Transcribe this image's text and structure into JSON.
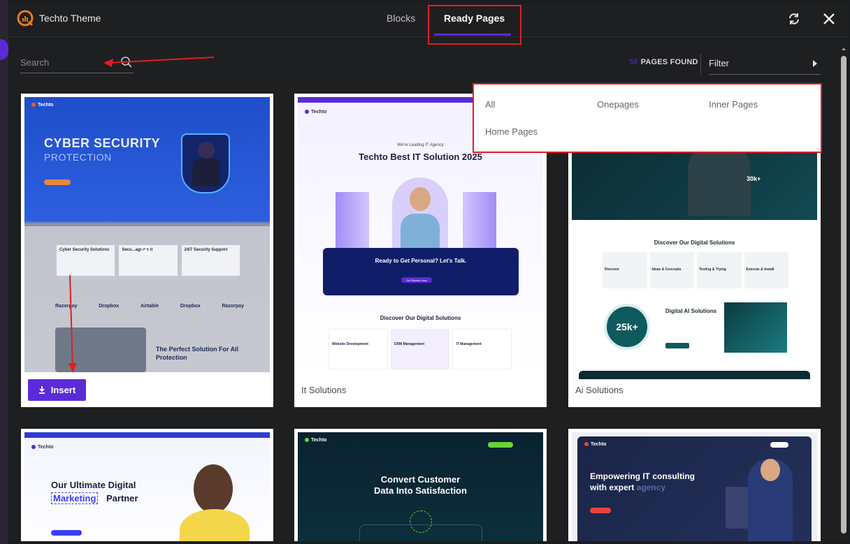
{
  "app": {
    "title": "Techto Theme"
  },
  "tabs": [
    {
      "label": "Blocks",
      "active": false
    },
    {
      "label": "Ready Pages",
      "active": true
    }
  ],
  "search": {
    "placeholder": "Search"
  },
  "results": {
    "count": "56",
    "label": "PAGES FOUND"
  },
  "filter": {
    "label": "Filter",
    "options": [
      "All",
      "Onepages",
      "Inner Pages",
      "Home Pages"
    ]
  },
  "cards": [
    {
      "caption": "",
      "insert_label": "Insert",
      "preview": {
        "logo": "Techto",
        "hero_title_1": "CYBER SECURITY",
        "hero_title_2": "PROTECTION",
        "service_1": "Cyber Security Solutions",
        "service_2": "Secu...agement",
        "service_3": "24/7 Security Support",
        "brands": [
          "Razorpay",
          "Dropbox",
          "Airtable",
          "Dropbox",
          "Razorpay"
        ],
        "about_title": "The Perfect Solution For All Protection"
      }
    },
    {
      "caption": "It Solutions",
      "preview": {
        "logo": "Techto",
        "tagline": "We're Leading IT Agency",
        "hero_title": "Techto Best IT Solution 2025",
        "cta_title": "Ready to Get Personal? Let's Talk.",
        "cta_button": "Get Started Now",
        "section_title": "Discover Our Digital Solutions",
        "services": [
          {
            "num": "03",
            "title": "Website Development"
          },
          {
            "num": "04",
            "title": "CRM Management"
          },
          {
            "num": "01",
            "title": "IT Management"
          }
        ]
      }
    },
    {
      "caption": "Ai Solutions",
      "preview": {
        "hero_stat": "30k+",
        "section_title": "Discover Our Digital Solutions",
        "steps": [
          "Discover",
          "Ideas & Concepts",
          "Testing & Trying",
          "Execute & Install"
        ],
        "stat_big": "25k+",
        "ai_title": "Digital AI Solutions"
      }
    },
    {
      "caption": "",
      "preview": {
        "logo": "Techto",
        "hero_title_1": "Our Ultimate Digital",
        "hero_title_2": "Marketing",
        "hero_title_3": "Partner"
      }
    },
    {
      "caption": "",
      "preview": {
        "logo": "Techto",
        "hero_title_1": "Convert Customer",
        "hero_title_2": "Data Into Satisfaction"
      }
    },
    {
      "caption": "",
      "preview": {
        "logo": "Techto",
        "hero_title_1": "Empowering IT consulting",
        "hero_title_2": "with expert",
        "hero_title_3": "agency"
      }
    }
  ],
  "colors": {
    "accent": "#5b2bd8",
    "annotation_red": "#e01e24",
    "background": "#1e1f21"
  },
  "icons": {
    "sync": "sync-icon",
    "close": "close-icon",
    "search": "search-icon",
    "zoom": "zoom-icon",
    "download": "download-icon"
  }
}
